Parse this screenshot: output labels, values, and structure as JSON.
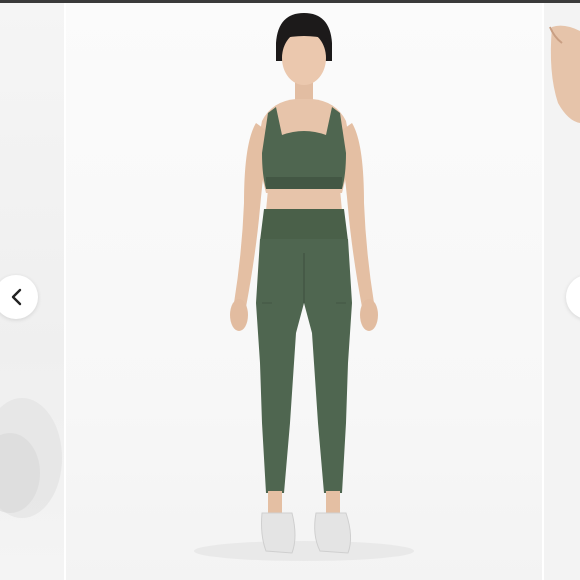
{
  "colors": {
    "top_bar": "#3a3a3a",
    "background": "#f7f7f7",
    "garment": "#4f6650",
    "garment_dark": "#435744",
    "skin": "#e7c4aa",
    "hair": "#1c1a1a",
    "shoes": "#e4e4e4"
  },
  "carousel": {
    "prev_icon": "chevron-left-icon",
    "next_icon": "chevron-right-icon"
  }
}
